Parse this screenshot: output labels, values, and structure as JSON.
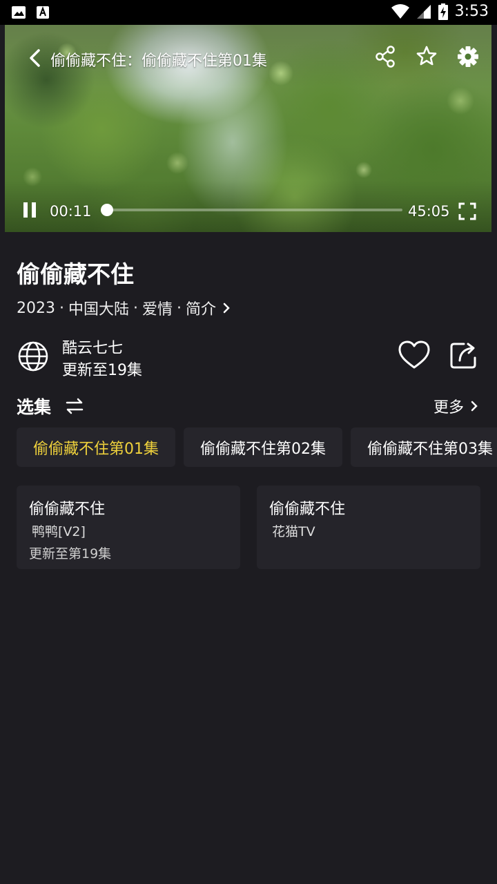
{
  "status_bar": {
    "time": "3:53"
  },
  "player": {
    "title": "偷偷藏不住：偷偷藏不住第01集",
    "current_time": "00:11",
    "total_time": "45:05",
    "progress": 0.004
  },
  "show": {
    "title": "偷偷藏不住",
    "year": "2023",
    "region": "中国大陆",
    "genre": "爱情",
    "intro_label": "简介",
    "separator": "·"
  },
  "source": {
    "name": "酷云七七",
    "update": "更新至19集"
  },
  "episodes": {
    "label": "选集",
    "more_label": "更多",
    "items": [
      {
        "label": "偷偷藏不住第01集"
      },
      {
        "label": "偷偷藏不住第02集"
      },
      {
        "label": "偷偷藏不住第03集"
      }
    ]
  },
  "source_cards": [
    {
      "title": "偷偷藏不住",
      "source": "鸭鸭[V2]",
      "update": "更新至第19集"
    },
    {
      "title": "偷偷藏不住",
      "source": "花猫TV",
      "update": ""
    }
  ],
  "colors": {
    "background": "#1d1c21",
    "accent": "#f0d23c",
    "chip": "#26252b"
  }
}
